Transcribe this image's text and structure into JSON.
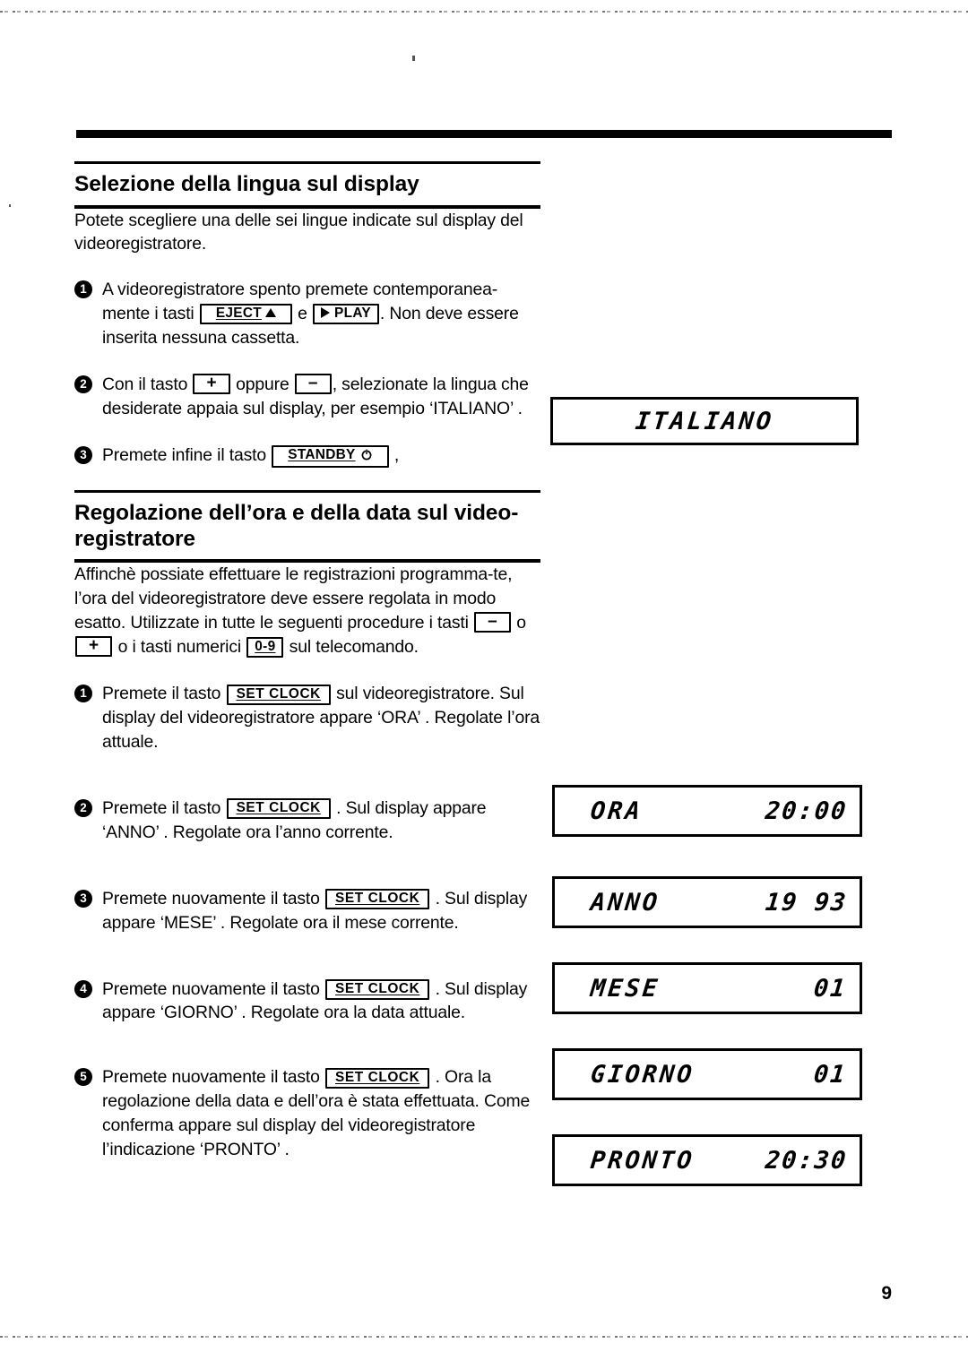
{
  "page": {
    "number": "9",
    "language": "Italiano"
  },
  "sections": [
    {
      "id": "lingua",
      "title": "Selezione della lingua sul display",
      "intro": "Potete scegliere una delle sei lingue indicate sul display del videoregistratore.",
      "steps": [
        {
          "number": "1",
          "parts": {
            "a": "A videoregistratore spento premete contemporanea-mente i tasti ",
            "key1": "EJECT",
            "b": " e ",
            "key2": "PLAY",
            "c": ". Non deve essere inserita nessuna cassetta."
          }
        },
        {
          "number": "2",
          "parts": {
            "a": "Con il tasto ",
            "key1": "+",
            "b": " oppure ",
            "key2": "–",
            "c": ", selezionate la lingua che desiderate appaia sul display, per esempio ‘ITALIANO’ ."
          }
        },
        {
          "number": "3",
          "parts": {
            "a": "Premete infine il tasto ",
            "key1": "STANDBY",
            "b": " ,",
            "key2": "",
            "c": ""
          }
        }
      ]
    },
    {
      "id": "ora-data",
      "title": "Regolazione dell’ora e della data sul video-registratore",
      "intro": {
        "a": "Affinchè possiate effettuare le registrazioni programma-te, l’ora del videoregistratore deve essere regolata in modo esatto. Utilizzate in tutte le seguenti procedure i tasti ",
        "key1": "–",
        "b": " o ",
        "key2": "+",
        "c": " o i tasti numerici ",
        "key3": "0-9",
        "d": " sul telecomando."
      },
      "steps": [
        {
          "number": "1",
          "parts": {
            "a": "Premete il tasto ",
            "key1": "SET  CLOCK",
            "b": " sul videoregistratore. Sul display del videoregistratore appare ‘ORA’ . Regolate l’ora attuale."
          }
        },
        {
          "number": "2",
          "parts": {
            "a": "Premete il tasto ",
            "key1": "SET  CLOCK",
            "b": " . Sul display appare ‘ANNO’ . Regolate ora l’anno corrente."
          }
        },
        {
          "number": "3",
          "parts": {
            "a": "Premete nuovamente il tasto ",
            "key1": "SET  CLOCK",
            "b": " . Sul display appare ‘MESE’ . Regolate ora il mese corrente."
          }
        },
        {
          "number": "4",
          "parts": {
            "a": "Premete nuovamente il tasto ",
            "key1": "SET  CLOCK",
            "b": " . Sul display appare ‘GIORNO’ . Regolate ora la data attuale."
          }
        },
        {
          "number": "5",
          "parts": {
            "a": "Premete nuovamente il tasto ",
            "key1": "SET  CLOCK",
            "b": " . Ora la regolazione della data e dell’ora è stata effettuata. Come conferma appare sul display del videoregistratore l’indicazione ‘PRONTO’ ."
          }
        }
      ]
    }
  ],
  "displays": [
    {
      "id": "lingua",
      "label": "ITALIANO",
      "value": "",
      "centered": true
    },
    {
      "id": "ora",
      "label": "ORA",
      "value": "20:00",
      "centered": false
    },
    {
      "id": "anno",
      "label": "ANNO",
      "value": "19 93",
      "centered": false
    },
    {
      "id": "mese",
      "label": "MESE",
      "value": "01",
      "centered": false
    },
    {
      "id": "giorno",
      "label": "GIORNO",
      "value": "01",
      "centered": false
    },
    {
      "id": "pronto",
      "label": "PRONTO",
      "value": "20:30",
      "centered": false
    }
  ],
  "icons": {
    "eject": "eject-triangle-up-icon",
    "play": "play-triangle-right-icon",
    "standby": "power-standby-icon"
  },
  "colors": {
    "ink": "#000000",
    "paper": "#ffffff"
  }
}
